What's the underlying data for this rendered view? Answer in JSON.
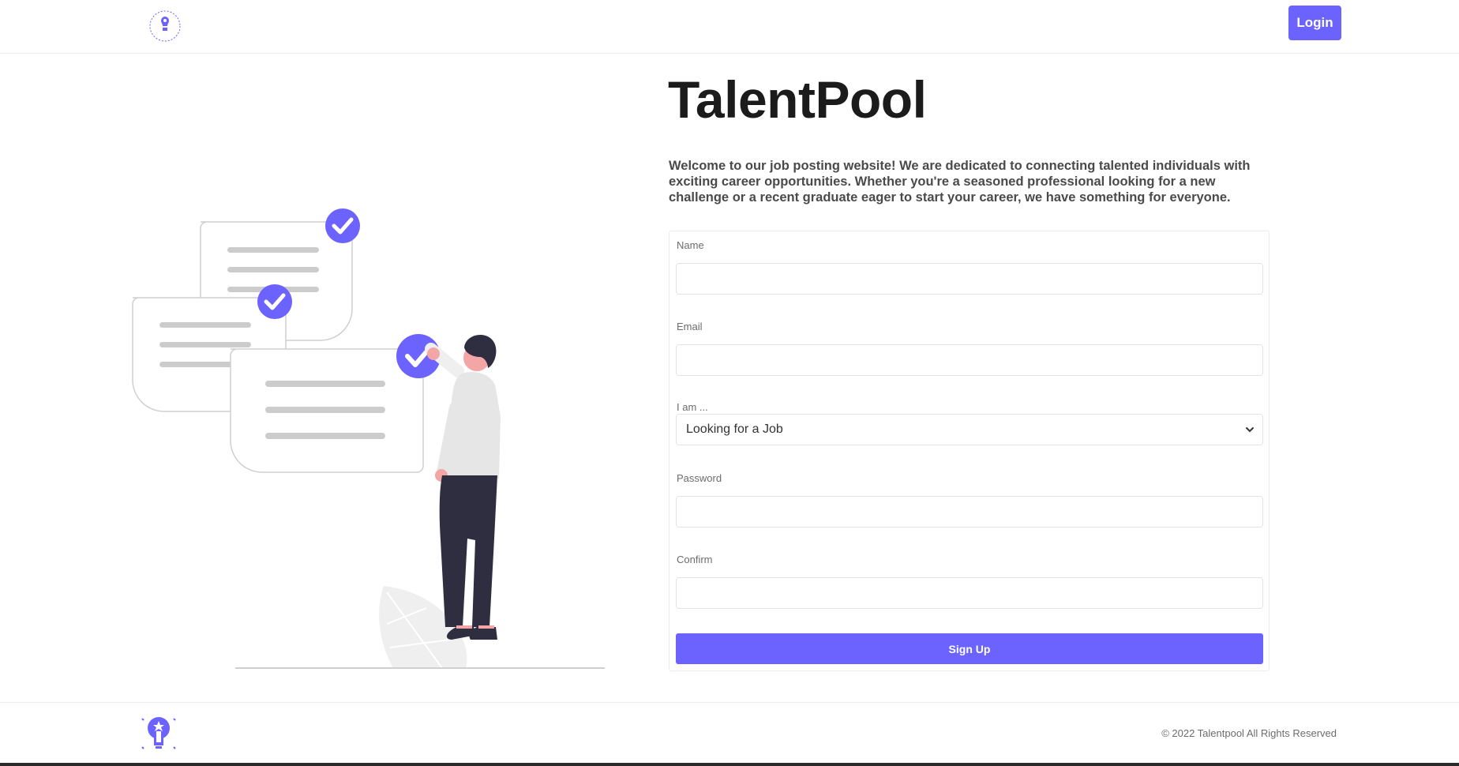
{
  "header": {
    "login_label": "Login"
  },
  "hero": {
    "title": "TalentPool",
    "intro": "Welcome to our job posting website! We are dedicated to connecting talented individuals with exciting career opportunities. Whether you're a seasoned professional looking for a new challenge or a recent graduate eager to start your career, we have something for everyone."
  },
  "form": {
    "name_label": "Name",
    "name_value": "",
    "email_label": "Email",
    "email_value": "",
    "role_label": "I am ...",
    "role_selected": "Looking for a Job",
    "password_label": "Password",
    "password_value": "",
    "confirm_label": "Confirm",
    "confirm_value": "",
    "submit_label": "Sign Up"
  },
  "footer": {
    "copyright": "© 2022 Talentpool All Rights Reserved"
  },
  "colors": {
    "accent": "#6c63ff",
    "text_dark": "#1b1b1b",
    "muted": "#6c6c6c"
  },
  "icons": {
    "logo": "lightbulb-logo-icon",
    "select": "chevron-down-icon",
    "check": "check-circle-icon"
  }
}
